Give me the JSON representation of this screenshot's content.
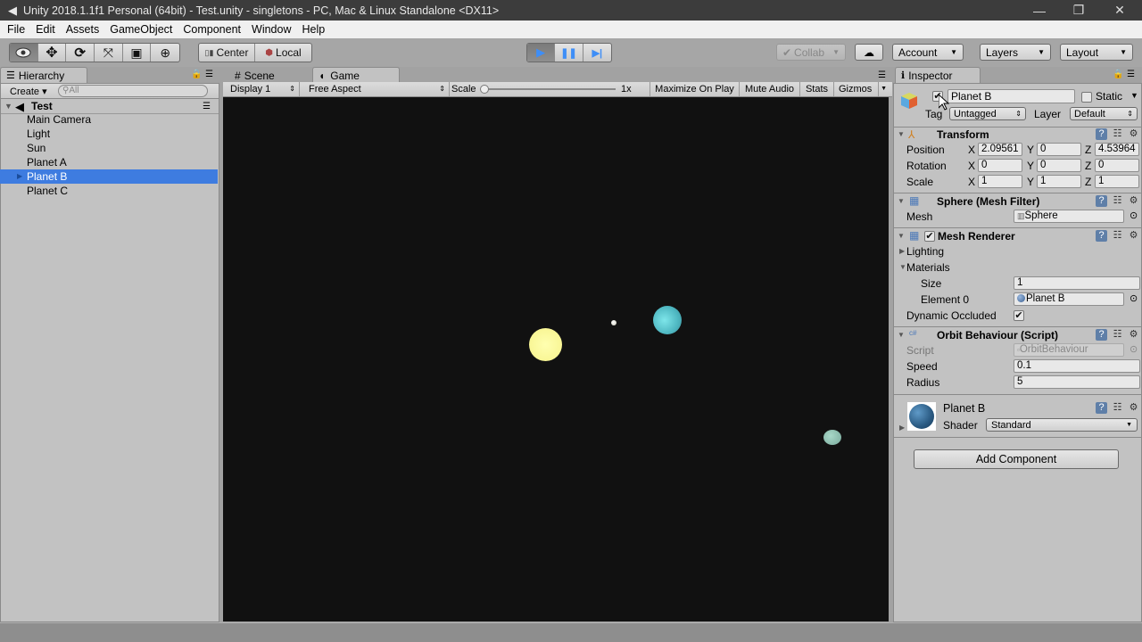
{
  "window": {
    "title": "Unity 2018.1.1f1 Personal (64bit) - Test.unity - singletons - PC, Mac & Linux Standalone <DX11>",
    "logo_icon": "unity-logo-icon",
    "minimize": "—",
    "maximize": "❐",
    "close": "✕"
  },
  "menu": [
    "File",
    "Edit",
    "Assets",
    "GameObject",
    "Component",
    "Window",
    "Help"
  ],
  "toolbar": {
    "tools": [
      {
        "name": "view-tool",
        "glyph": "👁"
      },
      {
        "name": "move-tool",
        "glyph": "✥"
      },
      {
        "name": "rotate-tool",
        "glyph": "⟳"
      },
      {
        "name": "scale-tool",
        "glyph": "⤧"
      },
      {
        "name": "rect-tool",
        "glyph": "▣"
      },
      {
        "name": "transform-tool",
        "glyph": "⊕"
      }
    ],
    "pivot": "Center",
    "space": "Local",
    "play": "▶",
    "pause": "❚❚",
    "step": "▶|",
    "collab": "Collab",
    "cloud": "☁",
    "account": "Account",
    "layers": "Layers",
    "layout": "Layout",
    "accent": "#3e8ef7"
  },
  "hierarchy": {
    "tab": "Hierarchy",
    "create": "Create",
    "search_placeholder": "All",
    "scene": "Test",
    "items": [
      {
        "label": "Main Camera",
        "selected": false
      },
      {
        "label": "Light",
        "selected": false
      },
      {
        "label": "Sun",
        "selected": false
      },
      {
        "label": "Planet A",
        "selected": false
      },
      {
        "label": "Planet B",
        "selected": true
      },
      {
        "label": "Planet C",
        "selected": false
      }
    ],
    "selection_color": "#3e7ce0"
  },
  "game": {
    "tabs": {
      "scene": "Scene",
      "game": "Game"
    },
    "display": "Display 1",
    "aspect": "Free Aspect",
    "scale_label": "Scale",
    "scale_value": "1x",
    "maximize": "Maximize On Play",
    "mute": "Mute Audio",
    "stats": "Stats",
    "gizmos": "Gizmos",
    "background": "#111111",
    "objects": [
      {
        "name": "sun",
        "color": "#fdfd9a"
      },
      {
        "name": "planet-a",
        "color": "#e8e8d8"
      },
      {
        "name": "planet-b",
        "color": "#4fc4cc"
      },
      {
        "name": "planet-c",
        "color": "#8ec4b0"
      }
    ]
  },
  "inspector": {
    "tab": "Inspector",
    "object_name": "Planet B",
    "active": true,
    "static_label": "Static",
    "tag_label": "Tag",
    "tag": "Untagged",
    "layer_label": "Layer",
    "layer": "Default",
    "transform": {
      "title": "Transform",
      "rows": [
        {
          "label": "Position",
          "x": "2.09561",
          "y": "0",
          "z": "4.53964"
        },
        {
          "label": "Rotation",
          "x": "0",
          "y": "0",
          "z": "0"
        },
        {
          "label": "Scale",
          "x": "1",
          "y": "1",
          "z": "1"
        }
      ]
    },
    "mesh_filter": {
      "title": "Sphere (Mesh Filter)",
      "mesh_label": "Mesh",
      "mesh": "Sphere"
    },
    "mesh_renderer": {
      "title": "Mesh Renderer",
      "lighting": "Lighting",
      "materials": "Materials",
      "size_label": "Size",
      "size": "1",
      "element_label": "Element 0",
      "element": "Planet B",
      "dynamic_label": "Dynamic Occluded"
    },
    "orbit": {
      "title": "Orbit Behaviour (Script)",
      "script_label": "Script",
      "script": "OrbitBehaviour",
      "speed_label": "Speed",
      "speed": "0.1",
      "radius_label": "Radius",
      "radius": "5"
    },
    "material": {
      "name": "Planet B",
      "shader_label": "Shader",
      "shader": "Standard"
    },
    "add_component": "Add Component"
  }
}
